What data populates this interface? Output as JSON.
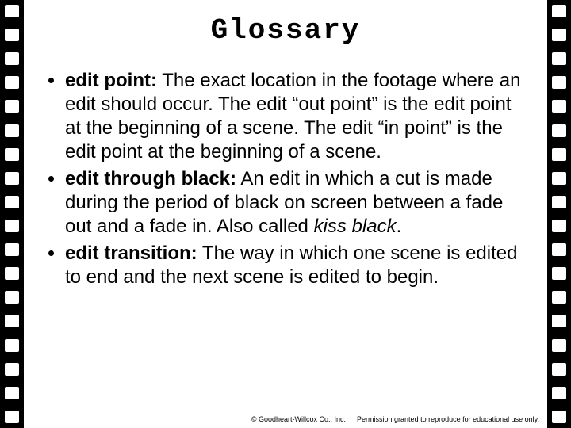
{
  "title": "Glossary",
  "entries": [
    {
      "term": "edit point:",
      "def_before": " The exact location in the footage where an edit should occur. The edit “out point” is the edit point at the beginning of a scene. The edit “in point” is the edit point at the beginning of a scene.",
      "aka": "",
      "def_after": ""
    },
    {
      "term": "edit through black:",
      "def_before": " An edit in which a cut is made during the period of black on screen between a fade out and a fade in. Also called ",
      "aka": "kiss black",
      "def_after": "."
    },
    {
      "term": "edit transition:",
      "def_before": " The way in which one scene is edited to end and the next scene is edited to begin.",
      "aka": "",
      "def_after": ""
    }
  ],
  "footer": {
    "copyright": "© Goodheart-Willcox Co., Inc.",
    "permission": "Permission granted to reproduce for educational use only."
  }
}
